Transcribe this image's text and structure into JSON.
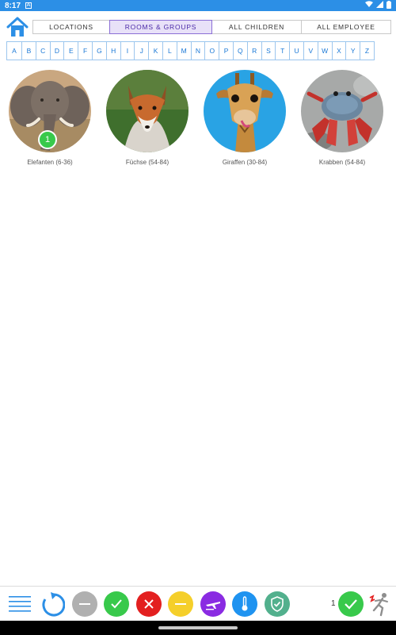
{
  "status_bar": {
    "time": "8:17",
    "notification_glyph": "A"
  },
  "header": {
    "home_icon": "home-icon",
    "tabs": [
      {
        "label": "LOCATIONS",
        "active": false
      },
      {
        "label": "ROOMS & GROUPS",
        "active": true
      },
      {
        "label": "ALL CHILDREN",
        "active": false
      },
      {
        "label": "ALL EMPLOYEE",
        "active": false
      }
    ]
  },
  "alphabet": [
    "A",
    "B",
    "C",
    "D",
    "E",
    "F",
    "G",
    "H",
    "I",
    "J",
    "K",
    "L",
    "M",
    "N",
    "O",
    "P",
    "Q",
    "R",
    "S",
    "T",
    "U",
    "V",
    "W",
    "X",
    "Y",
    "Z"
  ],
  "groups": [
    {
      "label": "Elefanten (6-36)",
      "image": "elephant",
      "badge": "1"
    },
    {
      "label": "Füchse (54-84)",
      "image": "fox"
    },
    {
      "label": "Giraffen (30-84)",
      "image": "giraffe"
    },
    {
      "label": "Krabben (54-84)",
      "image": "crab"
    }
  ],
  "bottom_bar": {
    "count": "1",
    "colors": {
      "accent": "#2c8fe6",
      "grey": "#b0b0b0",
      "green": "#38c94b",
      "red": "#e32020",
      "yellow": "#f5cf2a",
      "purple": "#8a2be2",
      "blue": "#1f93f0",
      "teal": "#52b08d"
    }
  }
}
